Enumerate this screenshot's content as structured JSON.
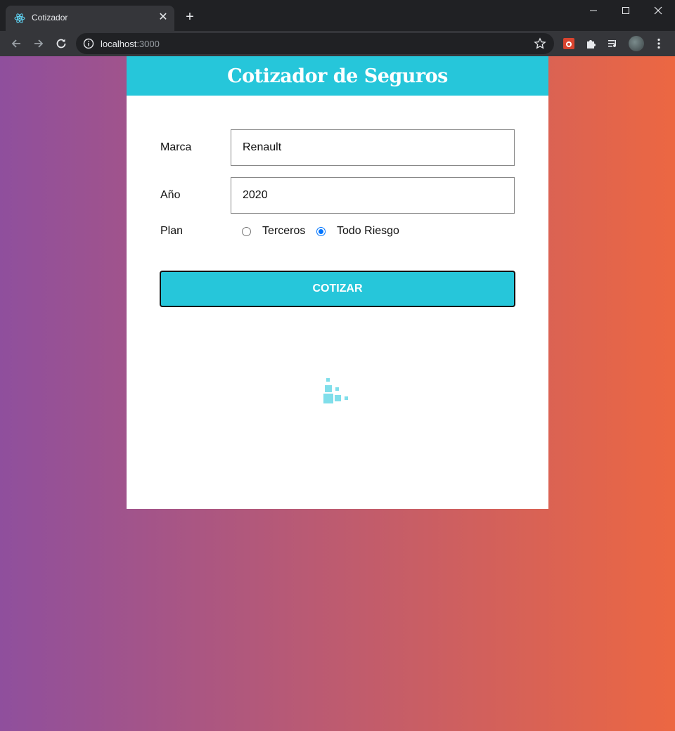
{
  "browser": {
    "tab_title": "Cotizador",
    "tab_close": "✕",
    "new_tab": "+",
    "url_host": "localhost",
    "url_port": ":3000"
  },
  "header": {
    "title": "Cotizador de Seguros",
    "background": "#26c6da"
  },
  "form": {
    "marca_label": "Marca",
    "marca_value": "Renault",
    "anio_label": "Año",
    "anio_value": "2020",
    "plan_label": "Plan",
    "plan_options": [
      {
        "label": "Terceros",
        "checked": false
      },
      {
        "label": "Todo Riesgo",
        "checked": true
      }
    ],
    "submit_label": "COTIZAR"
  },
  "colors": {
    "gradient_left": "#8f4f9d",
    "gradient_right": "#ec6742",
    "accent": "#26c6da",
    "spinner": "#80deea"
  },
  "icons": [
    "react-favicon-icon",
    "close-icon",
    "plus-icon",
    "minimize-icon",
    "maximize-icon",
    "window-close-icon",
    "back-arrow-icon",
    "forward-arrow-icon",
    "reload-icon",
    "info-icon",
    "star-icon",
    "extension-icon",
    "puzzle-icon",
    "media-queue-icon",
    "avatar",
    "kebab-menu-icon",
    "loading-spinner-icon"
  ]
}
